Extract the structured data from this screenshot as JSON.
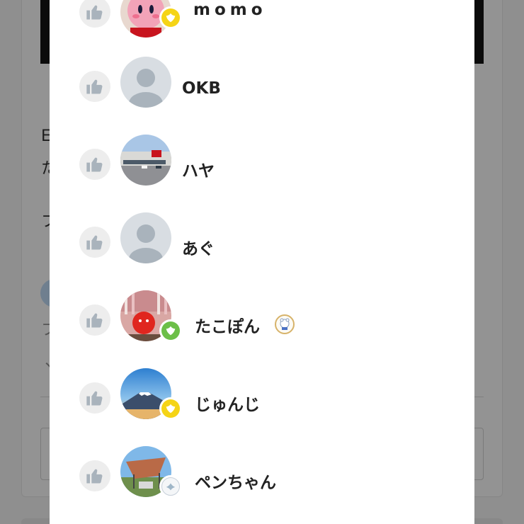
{
  "likes_list": {
    "users": [
      {
        "name": "momo",
        "avatar": "kirby-plush-photo",
        "badge": "yellow-leaf-badge"
      },
      {
        "name": "OKB",
        "avatar": "default-avatar",
        "badge": ""
      },
      {
        "name": "ハヤ",
        "avatar": "store-building-photo",
        "badge": ""
      },
      {
        "name": "あぐ",
        "avatar": "default-avatar",
        "badge": ""
      },
      {
        "name": "たこぽん",
        "avatar": "red-plush-photo",
        "badge": "green-leaf-badge",
        "sticker": "bear-sticker-icon"
      },
      {
        "name": "じゅんじ",
        "avatar": "mount-fuji-photo",
        "badge": "yellow-leaf-badge"
      },
      {
        "name": "ペンちゃん",
        "avatar": "tent-photo",
        "badge": "silver-wing-badge"
      }
    ],
    "like_icon": "thumbs-up-icon"
  },
  "colors": {
    "overlay": "#8f8f8f",
    "modal_bg": "#ffffff",
    "like_circle": "#ededed",
    "like_icon": "#a9b3bc",
    "name_text": "#222222"
  }
}
